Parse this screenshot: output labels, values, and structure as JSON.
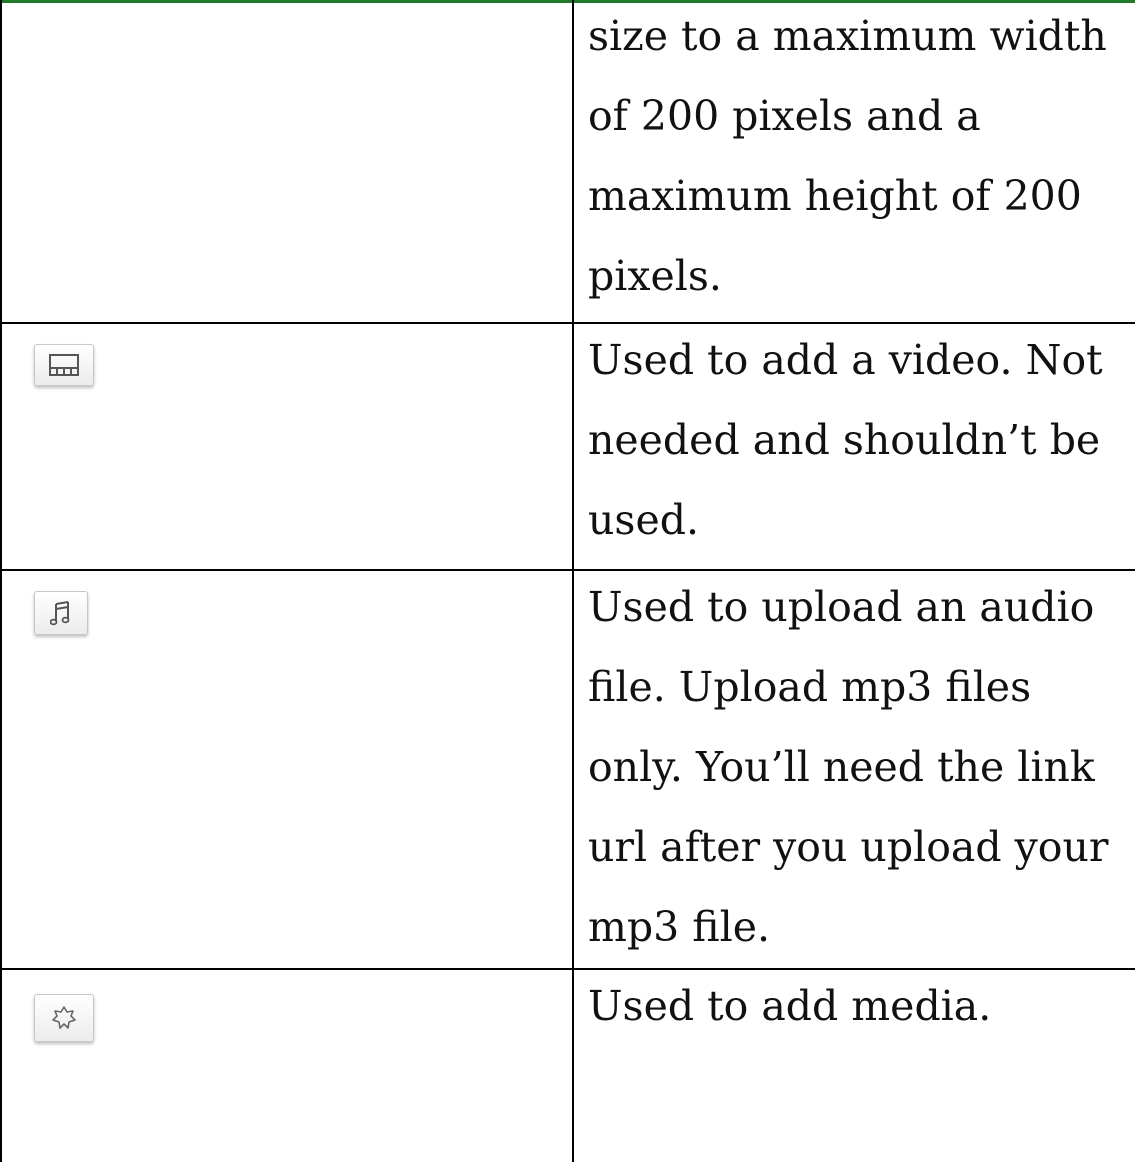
{
  "rows": [
    {
      "icon": "none",
      "description": "size to a maximum width of 200 pixels and a maximum height of 200 pixels."
    },
    {
      "icon": "video-icon",
      "description": "Used to add a video. Not needed and shouldn’t be used."
    },
    {
      "icon": "audio-icon",
      "description": "Used to upload an audio file. Upload mp3 files only. You’ll need the link url after you upload your mp3 file."
    },
    {
      "icon": "media-icon",
      "description": "Used to add media."
    }
  ],
  "colors": {
    "top_rule": "#1f7a2a",
    "grid": "#000000"
  }
}
